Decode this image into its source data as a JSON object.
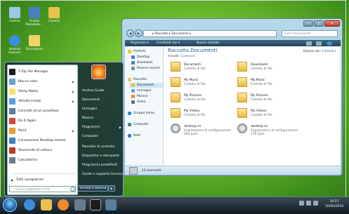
{
  "desktop": {
    "icons": [
      {
        "label": "Cestino",
        "icon": "recycle-bin-icon",
        "color": "#9ac8e8"
      },
      {
        "label": "FineUp Manutenz...",
        "icon": "tuneup-icon",
        "color": "#4a7fc0"
      },
      {
        "label": "Cartella",
        "icon": "folder-icon",
        "color": "#e8c24a"
      },
      {
        "label": "Internet Explorer",
        "icon": "ie-icon",
        "color": "#3a8fd8"
      },
      {
        "label": "Documento",
        "icon": "document-icon",
        "color": "#f2d46a"
      }
    ]
  },
  "start_menu": {
    "left_items": [
      {
        "label": "7-Zip File Manager",
        "icon": "7zip-icon",
        "color": "#1d1d1d",
        "arrow": ""
      },
      {
        "label": "Blocco note",
        "icon": "notepad-icon",
        "color": "#6ba3d6",
        "arrow": "▶"
      },
      {
        "label": "Sticky Notes",
        "icon": "sticky-notes-icon",
        "color": "#f3e36c",
        "arrow": "▶"
      },
      {
        "label": "Attività iniziali",
        "icon": "getting-started-icon",
        "color": "#4fa3e0",
        "arrow": "▶"
      },
      {
        "label": "Connetti ad un proiettore",
        "icon": "projector-icon",
        "color": "#5a7f9a",
        "arrow": ""
      },
      {
        "label": "Do It Again",
        "icon": "do-it-again-icon",
        "color": "#d14a3a",
        "arrow": ""
      },
      {
        "label": "Paint",
        "icon": "paint-icon",
        "color": "#e0a030",
        "arrow": "▶"
      },
      {
        "label": "Connessione Desktop remoto",
        "icon": "remote-desktop-icon",
        "color": "#3f7fc4",
        "arrow": ""
      },
      {
        "label": "Strumento di cattura",
        "icon": "snipping-tool-icon",
        "color": "#c0392b",
        "arrow": ""
      },
      {
        "label": "Calcolatrice",
        "icon": "calculator-icon",
        "color": "#6b7d8a",
        "arrow": ""
      }
    ],
    "all_programs": "Tutti i programmi",
    "search_placeholder": "Cerca programmi e file",
    "right_items": [
      "Andrea Guide",
      "Documenti",
      "Immagini",
      "Musica",
      "Programmi",
      "Computer",
      "Pannello di controllo",
      "Dispositivi e stampanti",
      "Programmi predefiniti",
      "Guida e supporto tecnico"
    ],
    "right_arrow": "▶",
    "shutdown_label": "Arresta il sistema",
    "shutdown_arrow": "▶"
  },
  "explorer": {
    "address": "▸ Raccolte ▸ Documenti ▸",
    "back": "◀",
    "forward": "▶",
    "search_placeholder": "Cerca Documenti",
    "toolbar": [
      "Organizza ▾",
      "Condividi con ▾",
      "Nuova cartella"
    ],
    "nav": [
      {
        "label": "Preferiti",
        "icon": "star-icon",
        "color": "#f2c230",
        "sel": false
      },
      {
        "label": "Desktop",
        "icon": "desktop-icon",
        "color": "#3f7fc4",
        "sel": false
      },
      {
        "label": "Download",
        "icon": "download-icon",
        "color": "#3f7fc4",
        "sel": false
      },
      {
        "label": "Risorse recenti",
        "icon": "recent-icon",
        "color": "#7a8a99",
        "sel": false
      },
      {
        "label": "Raccolte",
        "icon": "libraries-icon",
        "color": "#e8c24a",
        "sel": false
      },
      {
        "label": "Documenti",
        "icon": "documents-icon",
        "color": "#e8c24a",
        "sel": true
      },
      {
        "label": "Immagini",
        "icon": "pictures-icon",
        "color": "#5aa0d8",
        "sel": false
      },
      {
        "label": "Musica",
        "icon": "music-icon",
        "color": "#f08a30",
        "sel": false
      },
      {
        "label": "Video",
        "icon": "videos-icon",
        "color": "#5a6f80",
        "sel": false
      },
      {
        "label": "Gruppo home",
        "icon": "homegroup-icon",
        "color": "#2f8fd8",
        "sel": false
      },
      {
        "label": "Computer",
        "icon": "computer-icon",
        "color": "#5a7a90",
        "sel": false
      },
      {
        "label": "Rete",
        "icon": "network-icon",
        "color": "#3f7fc4",
        "sel": false
      }
    ],
    "library_title": "Raccolta Documenti",
    "includes_label": "Include:",
    "includes_value": "2 percorsi",
    "arrange_label": "Disponi per:",
    "arrange_value": "Cartella ▾",
    "files": [
      {
        "name": "Documenti",
        "type": "Cartella di file",
        "size": "",
        "kind": "folder"
      },
      {
        "name": "Downloads",
        "type": "Cartella di file",
        "size": "",
        "kind": "folder"
      },
      {
        "name": "My Music",
        "type": "Cartella di file",
        "size": "",
        "kind": "folder"
      },
      {
        "name": "My Music",
        "type": "Cartella di file",
        "size": "",
        "kind": "folder"
      },
      {
        "name": "My Pictures",
        "type": "Cartella di file",
        "size": "",
        "kind": "folder"
      },
      {
        "name": "My Pictures",
        "type": "Cartella di file",
        "size": "",
        "kind": "folder"
      },
      {
        "name": "My Videos",
        "type": "Cartella di file",
        "size": "",
        "kind": "folder"
      },
      {
        "name": "My Videos",
        "type": "Cartella di file",
        "size": "",
        "kind": "folder"
      },
      {
        "name": "desktop.ini",
        "type": "Impostazioni di configurazione",
        "size": "402 byte",
        "kind": "gear"
      },
      {
        "name": "desktop.ini",
        "type": "Impostazioni di configurazione",
        "size": "278 byte",
        "kind": "gear"
      }
    ],
    "status": "10 elementi"
  },
  "taskbar": {
    "items": [
      {
        "icon": "ie-taskbar-icon",
        "color": "#3a8fd8"
      },
      {
        "icon": "explorer-taskbar-icon",
        "color": "#e8c24a"
      },
      {
        "icon": "media-player-taskbar-icon",
        "color": "#f08a30"
      },
      {
        "icon": "calculator-taskbar-icon",
        "color": "#6b7d8a"
      },
      {
        "icon": "7zip-taskbar-icon",
        "color": "#1d1d1d"
      },
      {
        "icon": "monitor-taskbar-icon",
        "color": "#5a7f9a"
      }
    ],
    "time": "10:27",
    "date": "16/06/2010"
  }
}
